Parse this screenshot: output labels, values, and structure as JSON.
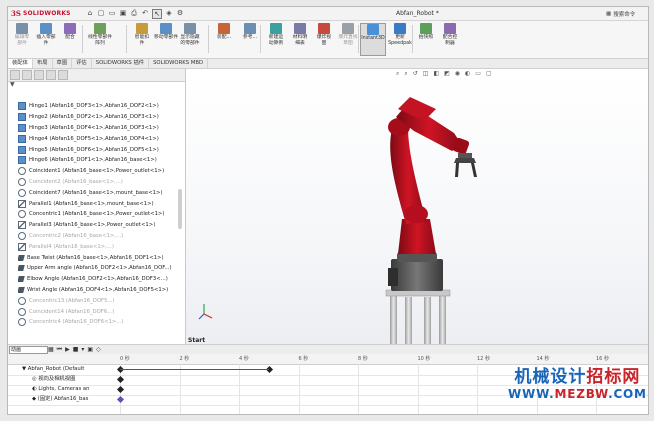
{
  "app": {
    "brand_ds": "3S",
    "brand": "SOLIDWORKS",
    "title": "Abfan_Robot *",
    "search_label": "搜索命令"
  },
  "toolbar": {
    "buttons": [
      {
        "label": "编辑零\n部件",
        "icon": "edit-component-icon",
        "dim": true
      },
      {
        "label": "插入零部\n件",
        "icon": "insert-component-icon",
        "dim": false
      },
      {
        "label": "配合",
        "icon": "mate-icon",
        "dim": false
      },
      {
        "label": "线性零部件阵列",
        "icon": "pattern-icon",
        "dim": false
      },
      {
        "label": "智能扣\n件",
        "icon": "smart-fastener-icon",
        "dim": false
      },
      {
        "label": "移动零部件",
        "icon": "move-component-icon",
        "dim": false
      },
      {
        "label": "显示隐藏\n的零部件",
        "icon": "show-hidden-icon",
        "dim": false
      },
      {
        "label": "装配...",
        "icon": "assembly-feature-icon",
        "dim": false
      },
      {
        "label": "参考...",
        "icon": "reference-geometry-icon",
        "dim": false
      },
      {
        "label": "新建运\n动算例",
        "icon": "new-motion-study-icon",
        "dim": false
      },
      {
        "label": "材料明\n细表",
        "icon": "bom-icon",
        "dim": false
      },
      {
        "label": "爆炸视\n图",
        "icon": "exploded-view-icon",
        "dim": false
      },
      {
        "label": "爆炸直线\n草图",
        "icon": "explode-line-icon",
        "dim": true
      },
      {
        "label": "Instant3D",
        "icon": "instant3d-icon",
        "dim": false,
        "active": true
      },
      {
        "label": "更新\nSpeedpak",
        "icon": "speedpak-icon",
        "dim": false
      },
      {
        "label": "拍快照",
        "icon": "snapshot-icon",
        "dim": false
      },
      {
        "label": "配合控\n制器",
        "icon": "mate-controller-icon",
        "dim": false
      }
    ]
  },
  "command_tabs": [
    "装配体",
    "布局",
    "草图",
    "评估",
    "SOLIDWORKS 插件",
    "SOLIDWORKS MBD"
  ],
  "feature_tree": [
    {
      "text": "Hinge1 (Abfan16_DOF3<1>,Abfan16_DOF2<1>)",
      "kind": "h",
      "dim": false
    },
    {
      "text": "Hinge2 (Abfan16_DOF2<1>,Abfan16_DOF3<1>)",
      "kind": "h",
      "dim": false
    },
    {
      "text": "Hinge3 (Abfan16_DOF4<1>,Abfan16_DOF3<1>)",
      "kind": "h",
      "dim": false
    },
    {
      "text": "Hinge4 (Abfan16_DOF5<1>,Abfan16_DOF4<1>)",
      "kind": "h",
      "dim": false
    },
    {
      "text": "Hinge5 (Abfan16_DOF6<1>,Abfan16_DOF5<1>)",
      "kind": "h",
      "dim": false
    },
    {
      "text": "Hinge6 (Abfan16_DOF1<1>,Abfan16_base<1>)",
      "kind": "h",
      "dim": false
    },
    {
      "text": "Coincident1 (Abfan16_base<1>,Power_outlet<1>)",
      "kind": "c",
      "dim": false
    },
    {
      "text": "Coincident2 (Abfan16_base<1>,...)",
      "kind": "c",
      "dim": true
    },
    {
      "text": "Coincident7 (Abfan16_base<1>,mount_base<1>)",
      "kind": "c",
      "dim": false
    },
    {
      "text": "Parallel1 (Abfan16_base<1>,mount_base<1>)",
      "kind": "p",
      "dim": false
    },
    {
      "text": "Concentric1 (Abfan16_base<1>,Power_outlet<1>)",
      "kind": "cc",
      "dim": false
    },
    {
      "text": "Parallel3 (Abfan16_base<1>,Power_outlet<1>)",
      "kind": "p",
      "dim": false
    },
    {
      "text": "Concentric2 (Abfan16_base<1>,...)",
      "kind": "cc",
      "dim": true
    },
    {
      "text": "Parallel4 (Abfan16_base<1>,...)",
      "kind": "p",
      "dim": true
    },
    {
      "text": "Base Twist (Abfan16_base<1>,Abfan16_DOF1<1>)",
      "kind": "a",
      "dim": false
    },
    {
      "text": "Upper Arm angle (Abfan16_DOF2<1>,Abfan16_DOF...)",
      "kind": "a",
      "dim": false
    },
    {
      "text": "Elbow Angle (Abfan16_DOF2<1>,Abfan16_DOF3<...)",
      "kind": "a",
      "dim": false
    },
    {
      "text": "Wrist Angle (Abfan16_DOF4<1>,Abfan16_DOF5<1>)",
      "kind": "a",
      "dim": false
    },
    {
      "text": "Concentric13 (Abfan16_DOF5...)",
      "kind": "cc",
      "dim": true
    },
    {
      "text": "Coincident14 (Abfan16_DOF6...)",
      "kind": "c",
      "dim": true
    },
    {
      "text": "Concentric4 (Abfan16_DOF6<1>...)",
      "kind": "cc",
      "dim": true
    }
  ],
  "viewport": {
    "start_label": "Start"
  },
  "motion": {
    "study_select": "动画"
  },
  "timeline": {
    "ticks": [
      "0 秒",
      "2 秒",
      "4 秒",
      "6 秒",
      "8 秒",
      "10 秒",
      "12 秒",
      "14 秒",
      "16 秒"
    ],
    "rows": [
      {
        "label": "Abfan_Robot (Default",
        "icon": "assembly-icon"
      },
      {
        "label": "视向及相机视图",
        "icon": "camera-view-icon"
      },
      {
        "label": "Lights, Cameras an",
        "icon": "lights-icon"
      },
      {
        "label": "(固定) Abfan16_bas",
        "icon": "part-icon"
      }
    ],
    "keyframes_seconds": [
      0,
      5
    ]
  },
  "watermark": {
    "line1_a": "机械设计",
    "line1_b": "招标网",
    "line2_a": "WWW.",
    "line2_b": "MEZBW",
    "line2_c": ".COM"
  },
  "colors": {
    "robot_red": "#c8102e",
    "brand_red": "#c8102e",
    "watermark_blue": "#1764b8",
    "watermark_red": "#c8242a"
  }
}
